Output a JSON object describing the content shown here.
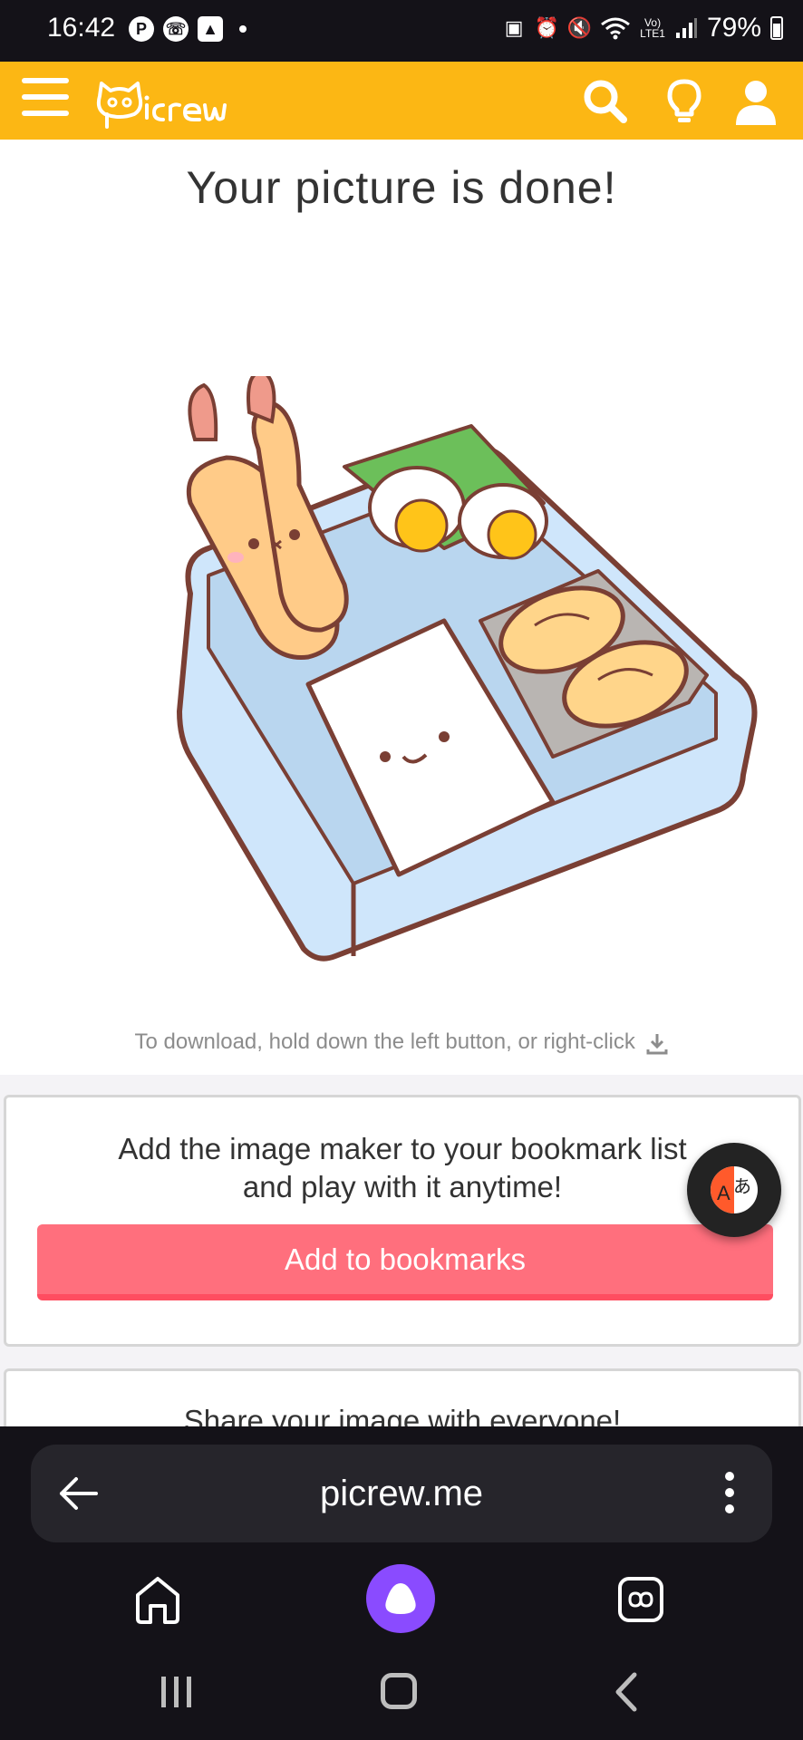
{
  "status_bar": {
    "time": "16:42",
    "battery": "79%",
    "left_icons": [
      "pinterest-icon",
      "whatsapp-icon",
      "gallery-icon"
    ],
    "right_icons": [
      "app-icon",
      "alarm-icon",
      "mute-icon",
      "wifi-icon",
      "volte-icon",
      "signal-icon",
      "battery-icon"
    ]
  },
  "header": {
    "logo": "Picrew",
    "accent_color": "#fcb714"
  },
  "main": {
    "title": "Your picture is done!",
    "download_hint": "To download, hold down the left button, or right-click",
    "bookmark_card": {
      "text_line1": "Add the image maker to your bookmark list",
      "text_line2": "and play with it anytime!",
      "button_label": "Add to bookmarks",
      "button_color": "#ff6f7d"
    },
    "share_card": {
      "text": "Share your image with everyone!"
    }
  },
  "browser": {
    "url": "picrew.me"
  }
}
